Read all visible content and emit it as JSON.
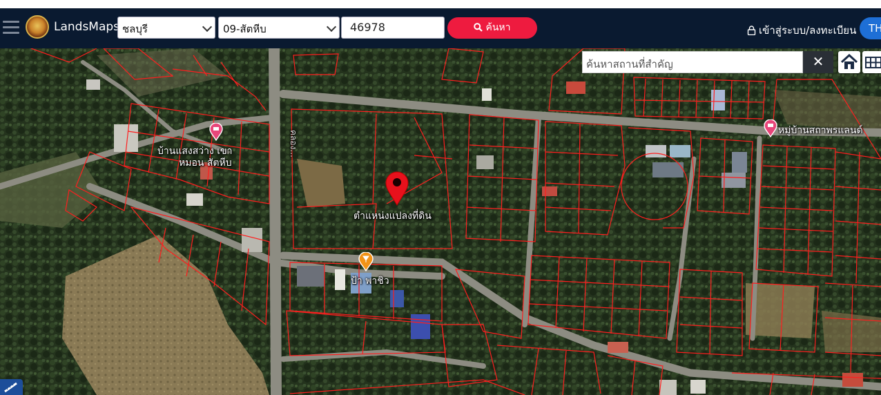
{
  "header": {
    "brand": "LandsMaps",
    "province": "ชลบุรี",
    "district": "09-สัตหีบ",
    "parcel_number": "46978",
    "search_label": "ค้นหา",
    "login_label": "เข้าสู่ระบบ/ลงทะเบียน",
    "language": "TH",
    "brand_colors": {
      "navbar": "#0a1a30",
      "search_button": "#ee1b3f",
      "language_button": "#1e6fd6"
    }
  },
  "map": {
    "poi_search_placeholder": "ค้นหาสถานที่สำคัญ",
    "close_symbol": "✕",
    "labels": {
      "parcel_marker": "ตำแหน่งแปลงที่ดิน",
      "poi_left_line1": "บ้านแสงสว่าง เขา",
      "poi_left_line2": "หมอน สัตหีบ",
      "poi_right": "หมู่บ้านสถาพรแลนด์",
      "poi_food": "ป้า พาชิว",
      "vertical_road": "คลอง..."
    },
    "icons": [
      "home-icon",
      "grid-icon",
      "ruler-icon",
      "map-pin-icon",
      "lock-icon",
      "search-icon"
    ]
  }
}
